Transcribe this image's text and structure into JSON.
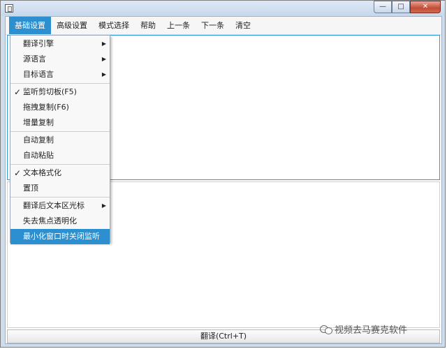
{
  "window": {
    "title": "",
    "controls": {
      "minimize": "—",
      "maximize": "□",
      "close": "✕"
    }
  },
  "menubar": {
    "items": [
      {
        "label": "基础设置",
        "active": true
      },
      {
        "label": "高级设置"
      },
      {
        "label": "模式选择"
      },
      {
        "label": "帮助"
      },
      {
        "label": "上一条"
      },
      {
        "label": "下一条"
      },
      {
        "label": "清空"
      }
    ]
  },
  "dropdown": {
    "items": [
      {
        "label": "翻译引擎",
        "submenu": true
      },
      {
        "label": "源语言",
        "submenu": true
      },
      {
        "label": "目标语言",
        "submenu": true
      },
      {
        "label": "监听剪切板(F5)",
        "checked": true
      },
      {
        "label": "拖拽复制(F6)"
      },
      {
        "label": "增量复制"
      },
      {
        "label": "自动复制"
      },
      {
        "label": "自动粘贴"
      },
      {
        "label": "文本格式化",
        "checked": true
      },
      {
        "label": "置顶"
      },
      {
        "label": "翻译后文本区光标",
        "submenu": true
      },
      {
        "label": "失去焦点透明化"
      },
      {
        "label": "最小化窗口时关闭监听",
        "highlighted": true
      }
    ],
    "check_glyph": "✓",
    "submenu_glyph": "▶"
  },
  "main": {
    "source_text": "",
    "result_text": "",
    "translate_button": "翻译(Ctrl+T)"
  },
  "watermark": {
    "text": "视频去马赛克软件",
    "icon": "wechat-icon"
  },
  "colors": {
    "accent": "#2b8fd0",
    "titlebar": "#cfdcec",
    "close": "#c44b36"
  }
}
